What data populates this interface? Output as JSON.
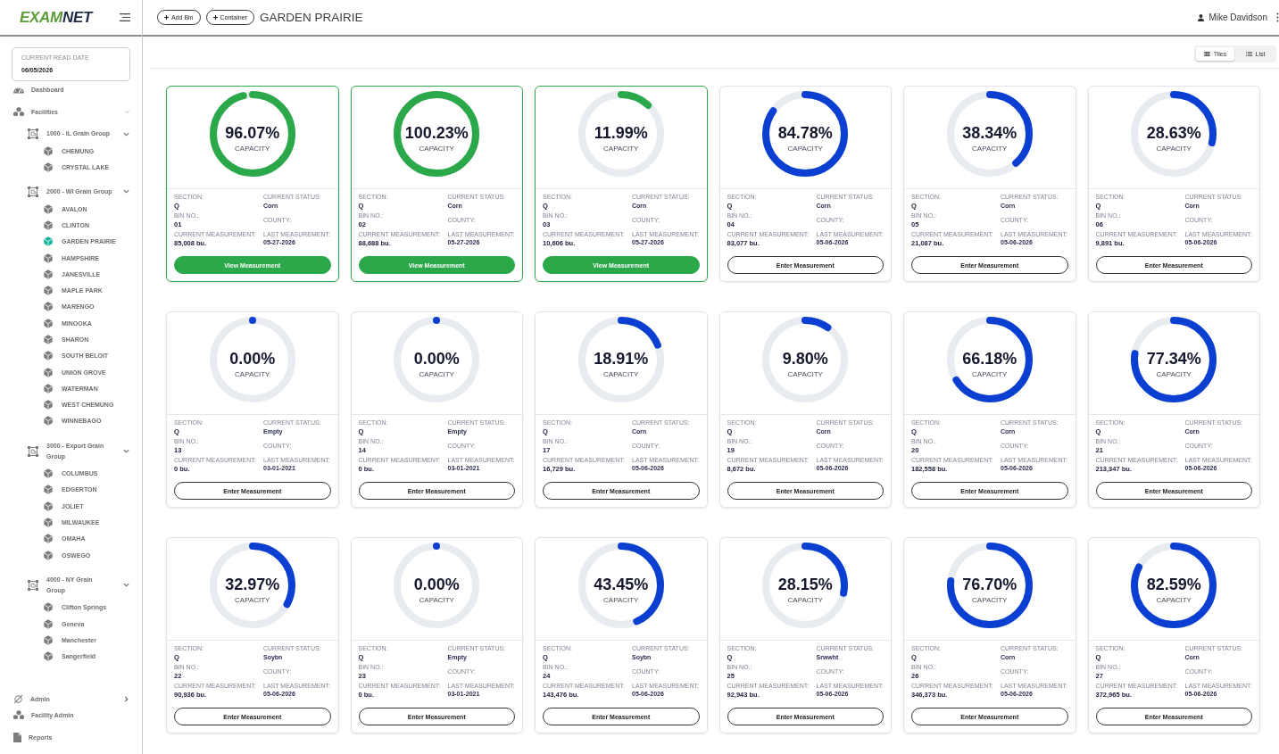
{
  "sidebar": {
    "logo": {
      "lead": "EXAM",
      "tail": "NET"
    },
    "read_date": {
      "label": "CURRENT READ DATE",
      "value": "06/05/2026"
    },
    "nav": [
      {
        "kind": "dashboard",
        "label": "Dashboard"
      },
      {
        "kind": "facilities",
        "label": "Facilities",
        "expanded": true,
        "children": [
          {
            "label": "1000 - IL Grain Group",
            "expanded": true,
            "children": [
              {
                "label": "CHEMUNG",
                "selected": false
              },
              {
                "label": "CRYSTAL LAKE",
                "selected": false
              }
            ]
          },
          {
            "label": "2000 - WI Grain Group",
            "expanded": true,
            "children": [
              {
                "label": "AVALON",
                "selected": false
              },
              {
                "label": "CLINTON",
                "selected": false
              },
              {
                "label": "GARDEN PRAIRIE",
                "selected": true
              },
              {
                "label": "HAMPSHIRE",
                "selected": false
              },
              {
                "label": "JANESVILLE",
                "selected": false
              },
              {
                "label": "MAPLE PARK",
                "selected": false
              },
              {
                "label": "MARENGO",
                "selected": false
              },
              {
                "label": "MINOOKA",
                "selected": false
              },
              {
                "label": "SHARON",
                "selected": false
              },
              {
                "label": "SOUTH BELOIT",
                "selected": false
              },
              {
                "label": "UNION GROVE",
                "selected": false
              },
              {
                "label": "WATERMAN",
                "selected": false
              },
              {
                "label": "WEST CHEMUNG",
                "selected": false
              },
              {
                "label": "WINNEBAGO",
                "selected": false
              }
            ]
          },
          {
            "label": "3000 - Export Grain Group",
            "expanded": true,
            "children": [
              {
                "label": "COLUMBUS",
                "selected": false
              },
              {
                "label": "EDGERTON",
                "selected": false
              },
              {
                "label": "JOLIET",
                "selected": false
              },
              {
                "label": "MILWAUKEE",
                "selected": false
              },
              {
                "label": "OMAHA",
                "selected": false
              },
              {
                "label": "OSWEGO",
                "selected": false
              }
            ]
          },
          {
            "label": "4000 - NY Grain Group",
            "expanded": true,
            "children": [
              {
                "label": "Clifton Springs",
                "selected": false
              },
              {
                "label": "Geneva",
                "selected": false
              },
              {
                "label": "Manchester",
                "selected": false
              },
              {
                "label": "Sangerfield",
                "selected": false
              }
            ]
          }
        ]
      }
    ],
    "bottom_nav": [
      {
        "kind": "admin",
        "label": "Admin",
        "expanded": false
      },
      {
        "kind": "facility_admin",
        "label": "Facility Admin"
      },
      {
        "kind": "reports",
        "label": "Reports"
      }
    ]
  },
  "header": {
    "buttons": [
      {
        "label": "Add Bin"
      },
      {
        "label": "Container"
      }
    ],
    "title": "GARDEN PRAIRIE",
    "user": "Mike Davidson"
  },
  "view_toggle": [
    {
      "label": "Tiles",
      "selected": true
    },
    {
      "label": "List",
      "selected": false
    }
  ],
  "bins": [
    {
      "kind": "measured",
      "percent": "96.07%",
      "caption": "CAPACITY",
      "level": 0.9607,
      "section_label": "SECTION:",
      "section": "Q",
      "bin_label": "BIN NO.:",
      "bin": "01",
      "measurement_label": "CURRENT MEASUREMENT:",
      "measurement": "85,008 bu.",
      "status_label": "CURRENT STATUS:",
      "status": "Corn",
      "county_label": "COUNTY:",
      "last_label": "LAST MEASUREMENT:",
      "last_date": "05-27-2026",
      "action": "View Measurement"
    },
    {
      "kind": "measured",
      "percent": "100.23%",
      "caption": "CAPACITY",
      "level": 1,
      "section_label": "SECTION:",
      "section": "Q",
      "bin_label": "BIN NO.:",
      "bin": "02",
      "measurement_label": "CURRENT MEASUREMENT:",
      "measurement": "88,688 bu.",
      "status_label": "CURRENT STATUS:",
      "status": "Corn",
      "county_label": "COUNTY:",
      "last_label": "LAST MEASUREMENT:",
      "last_date": "05-27-2026",
      "action": "View Measurement"
    },
    {
      "kind": "measured",
      "percent": "11.99%",
      "caption": "CAPACITY",
      "level": 0.1199,
      "section_label": "SECTION:",
      "section": "Q",
      "bin_label": "BIN NO.:",
      "bin": "03",
      "measurement_label": "CURRENT MEASUREMENT:",
      "measurement": "10,606 bu.",
      "status_label": "CURRENT STATUS:",
      "status": "Corn",
      "county_label": "COUNTY:",
      "last_label": "LAST MEASUREMENT:",
      "last_date": "05-27-2026",
      "action": "View Measurement"
    },
    {
      "kind": "pending",
      "percent": "84.78%",
      "caption": "CAPACITY",
      "level": 0.8478,
      "section_label": "SECTION:",
      "section": "Q",
      "bin_label": "BIN NO.:",
      "bin": "04",
      "measurement_label": "CURRENT MEASUREMENT:",
      "measurement": "83,077 bu.",
      "status_label": "CURRENT STATUS:",
      "status": "Corn",
      "county_label": "COUNTY:",
      "last_label": "LAST MEASUREMENT:",
      "last_date": "05-06-2026",
      "action": "Enter Measurement"
    },
    {
      "kind": "pending",
      "percent": "38.34%",
      "caption": "CAPACITY",
      "level": 0.3834,
      "section_label": "SECTION:",
      "section": "Q",
      "bin_label": "BIN NO.:",
      "bin": "05",
      "measurement_label": "CURRENT MEASUREMENT:",
      "measurement": "21,087 bu.",
      "status_label": "CURRENT STATUS:",
      "status": "Corn",
      "county_label": "COUNTY:",
      "last_label": "LAST MEASUREMENT:",
      "last_date": "05-06-2026",
      "action": "Enter Measurement"
    },
    {
      "kind": "pending",
      "percent": "28.63%",
      "caption": "CAPACITY",
      "level": 0.2863,
      "section_label": "SECTION:",
      "section": "Q",
      "bin_label": "BIN NO.:",
      "bin": "06",
      "measurement_label": "CURRENT MEASUREMENT:",
      "measurement": "9,891 bu.",
      "status_label": "CURRENT STATUS:",
      "status": "Corn",
      "county_label": "COUNTY:",
      "last_label": "LAST MEASUREMENT:",
      "last_date": "05-06-2026",
      "action": "Enter Measurement"
    },
    {
      "kind": "pending",
      "percent": "0.00%",
      "caption": "CAPACITY",
      "level": 0,
      "section_label": "SECTION:",
      "section": "Q",
      "bin_label": "BIN NO.:",
      "bin": "13",
      "measurement_label": "CURRENT MEASUREMENT:",
      "measurement": "0 bu.",
      "status_label": "CURRENT STATUS:",
      "status": "Empty",
      "county_label": "COUNTY:",
      "last_label": "LAST MEASUREMENT:",
      "last_date": "03-01-2021",
      "action": "Enter Measurement"
    },
    {
      "kind": "pending",
      "percent": "0.00%",
      "caption": "CAPACITY",
      "level": 0,
      "section_label": "SECTION:",
      "section": "Q",
      "bin_label": "BIN NO.:",
      "bin": "14",
      "measurement_label": "CURRENT MEASUREMENT:",
      "measurement": "0 bu.",
      "status_label": "CURRENT STATUS:",
      "status": "Empty",
      "county_label": "COUNTY:",
      "last_label": "LAST MEASUREMENT:",
      "last_date": "03-01-2021",
      "action": "Enter Measurement"
    },
    {
      "kind": "pending",
      "percent": "18.91%",
      "caption": "CAPACITY",
      "level": 0.1891,
      "section_label": "SECTION:",
      "section": "Q",
      "bin_label": "BIN NO.:",
      "bin": "17",
      "measurement_label": "CURRENT MEASUREMENT:",
      "measurement": "16,729 bu.",
      "status_label": "CURRENT STATUS:",
      "status": "Corn",
      "county_label": "COUNTY:",
      "last_label": "LAST MEASUREMENT:",
      "last_date": "05-06-2026",
      "action": "Enter Measurement"
    },
    {
      "kind": "pending",
      "percent": "9.80%",
      "caption": "CAPACITY",
      "level": 0.098,
      "section_label": "SECTION:",
      "section": "Q",
      "bin_label": "BIN NO.:",
      "bin": "19",
      "measurement_label": "CURRENT MEASUREMENT:",
      "measurement": "8,672 bu.",
      "status_label": "CURRENT STATUS:",
      "status": "Corn",
      "county_label": "COUNTY:",
      "last_label": "LAST MEASUREMENT:",
      "last_date": "05-06-2026",
      "action": "Enter Measurement"
    },
    {
      "kind": "pending",
      "percent": "66.18%",
      "caption": "CAPACITY",
      "level": 0.6618,
      "section_label": "SECTION:",
      "section": "Q",
      "bin_label": "BIN NO.:",
      "bin": "20",
      "measurement_label": "CURRENT MEASUREMENT:",
      "measurement": "182,558 bu.",
      "status_label": "CURRENT STATUS:",
      "status": "Corn",
      "county_label": "COUNTY:",
      "last_label": "LAST MEASUREMENT:",
      "last_date": "05-06-2026",
      "action": "Enter Measurement"
    },
    {
      "kind": "pending",
      "percent": "77.34%",
      "caption": "CAPACITY",
      "level": 0.7734,
      "section_label": "SECTION:",
      "section": "Q",
      "bin_label": "BIN NO.:",
      "bin": "21",
      "measurement_label": "CURRENT MEASUREMENT:",
      "measurement": "213,347 bu.",
      "status_label": "CURRENT STATUS:",
      "status": "Corn",
      "county_label": "COUNTY:",
      "last_label": "LAST MEASUREMENT:",
      "last_date": "05-06-2026",
      "action": "Enter Measurement"
    },
    {
      "kind": "pending",
      "percent": "32.97%",
      "caption": "CAPACITY",
      "level": 0.3297,
      "section_label": "SECTION:",
      "section": "Q",
      "bin_label": "BIN NO.:",
      "bin": "22",
      "measurement_label": "CURRENT MEASUREMENT:",
      "measurement": "90,936 bu.",
      "status_label": "CURRENT STATUS:",
      "status": "Soybn",
      "county_label": "COUNTY:",
      "last_label": "LAST MEASUREMENT:",
      "last_date": "05-06-2026",
      "action": "Enter Measurement"
    },
    {
      "kind": "pending",
      "percent": "0.00%",
      "caption": "CAPACITY",
      "level": 0,
      "section_label": "SECTION:",
      "section": "Q",
      "bin_label": "BIN NO.:",
      "bin": "23",
      "measurement_label": "CURRENT MEASUREMENT:",
      "measurement": "0 bu.",
      "status_label": "CURRENT STATUS:",
      "status": "Empty",
      "county_label": "COUNTY:",
      "last_label": "LAST MEASUREMENT:",
      "last_date": "03-01-2021",
      "action": "Enter Measurement"
    },
    {
      "kind": "pending",
      "percent": "43.45%",
      "caption": "CAPACITY",
      "level": 0.4345,
      "section_label": "SECTION:",
      "section": "Q",
      "bin_label": "BIN NO.:",
      "bin": "24",
      "measurement_label": "CURRENT MEASUREMENT:",
      "measurement": "143,476 bu.",
      "status_label": "CURRENT STATUS:",
      "status": "Soybn",
      "county_label": "COUNTY:",
      "last_label": "LAST MEASUREMENT:",
      "last_date": "05-06-2026",
      "action": "Enter Measurement"
    },
    {
      "kind": "pending",
      "percent": "28.15%",
      "caption": "CAPACITY",
      "level": 0.2815,
      "section_label": "SECTION:",
      "section": "Q",
      "bin_label": "BIN NO.:",
      "bin": "25",
      "measurement_label": "CURRENT MEASUREMENT:",
      "measurement": "92,943 bu.",
      "status_label": "CURRENT STATUS:",
      "status": "Srwwht",
      "county_label": "COUNTY:",
      "last_label": "LAST MEASUREMENT:",
      "last_date": "05-06-2026",
      "action": "Enter Measurement"
    },
    {
      "kind": "pending",
      "percent": "76.70%",
      "caption": "CAPACITY",
      "level": 0.767,
      "section_label": "SECTION:",
      "section": "Q",
      "bin_label": "BIN NO.:",
      "bin": "26",
      "measurement_label": "CURRENT MEASUREMENT:",
      "measurement": "346,373 bu.",
      "status_label": "CURRENT STATUS:",
      "status": "Corn",
      "county_label": "COUNTY:",
      "last_label": "LAST MEASUREMENT:",
      "last_date": "05-06-2026",
      "action": "Enter Measurement"
    },
    {
      "kind": "pending",
      "percent": "82.59%",
      "caption": "CAPACITY",
      "level": 0.8259,
      "section_label": "SECTION:",
      "section": "Q",
      "bin_label": "BIN NO.:",
      "bin": "27",
      "measurement_label": "CURRENT MEASUREMENT:",
      "measurement": "372,965 bu.",
      "status_label": "CURRENT STATUS:",
      "status": "Corn",
      "county_label": "COUNTY:",
      "last_label": "LAST MEASUREMENT:",
      "last_date": "05-06-2026",
      "action": "Enter Measurement"
    }
  ]
}
